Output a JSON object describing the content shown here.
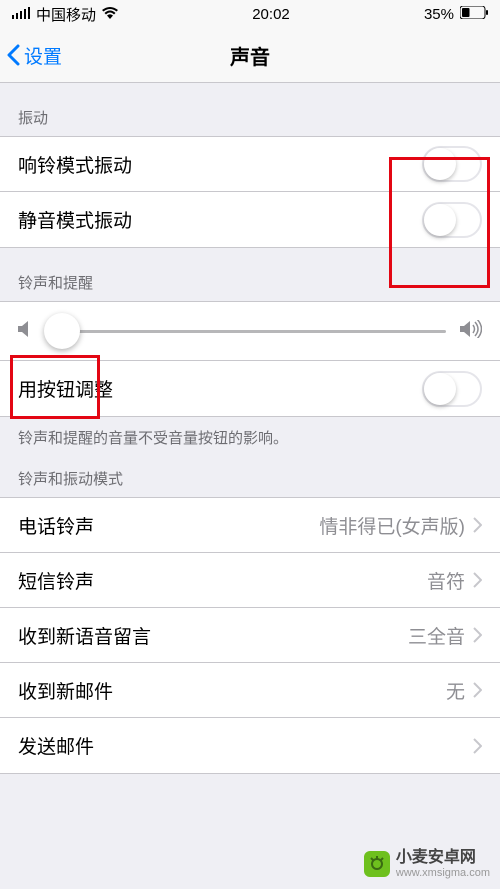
{
  "status": {
    "carrier": "中国移动",
    "time": "20:02",
    "battery": "35%"
  },
  "nav": {
    "back": "设置",
    "title": "声音"
  },
  "sections": {
    "vibration": {
      "header": "振动",
      "ring_vibrate": "响铃模式振动",
      "silent_vibrate": "静音模式振动"
    },
    "ringer": {
      "header": "铃声和提醒",
      "button_change": "用按钮调整",
      "footer": "铃声和提醒的音量不受音量按钮的影响。"
    },
    "patterns": {
      "header": "铃声和振动模式",
      "ringtone": {
        "label": "电话铃声",
        "value": "情非得已(女声版)"
      },
      "text_tone": {
        "label": "短信铃声",
        "value": "音符"
      },
      "voicemail": {
        "label": "收到新语音留言",
        "value": "三全音"
      },
      "new_mail": {
        "label": "收到新邮件",
        "value": "无"
      },
      "sent_mail": {
        "label": "发送邮件",
        "value": ""
      }
    }
  },
  "watermark": {
    "name": "小麦安卓网",
    "url": "www.xmsigma.com"
  }
}
